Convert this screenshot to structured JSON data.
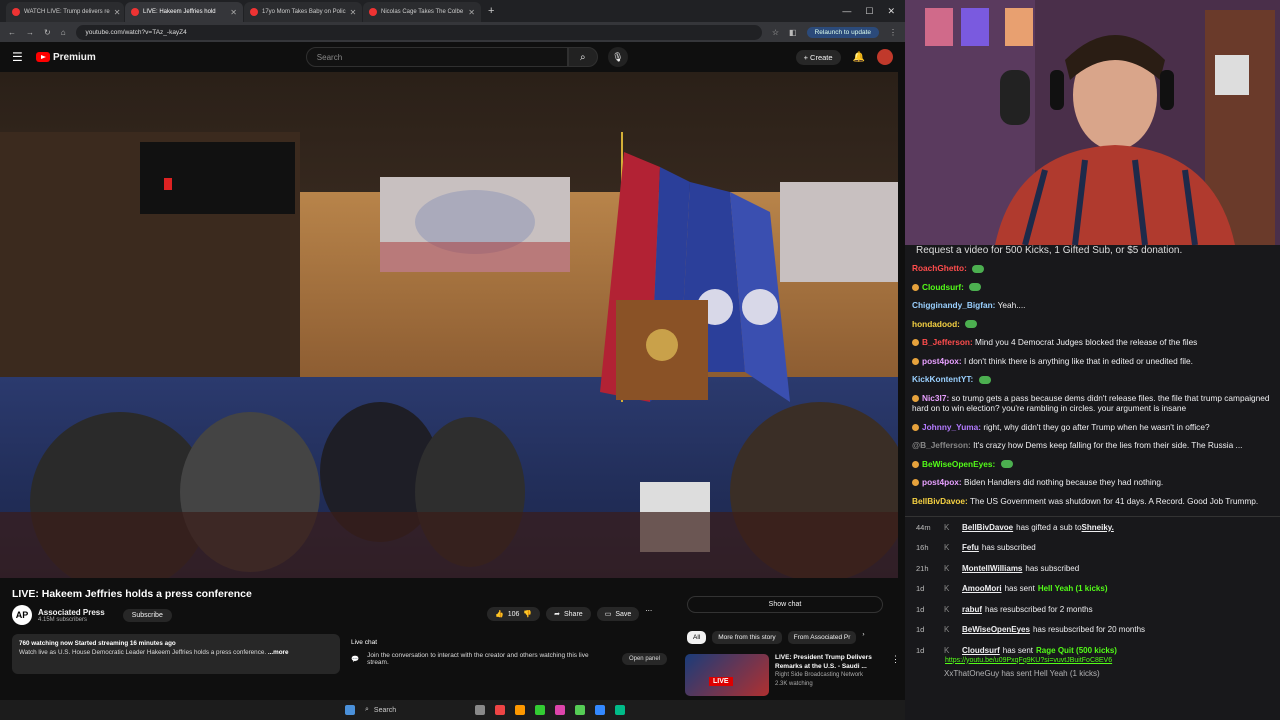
{
  "browser": {
    "tabs": [
      {
        "label": "WATCH LIVE: Trump delivers re"
      },
      {
        "label": "LIVE: Hakeem Jeffries hold"
      },
      {
        "label": "17yo Mom Takes Baby on Polic"
      },
      {
        "label": "Nicolas Cage Takes The Colbe"
      }
    ],
    "url": "youtube.com/watch?v=TAz_-kayZ4",
    "relaunch_label": "Relaunch to update"
  },
  "youtube": {
    "brand": "Premium",
    "search_placeholder": "Search",
    "create_label": "Create",
    "video_title": "LIVE: Hakeem Jeffries holds a press conference",
    "channel_initials": "AP",
    "channel_name": "Associated Press",
    "channel_subs": "4.15M subscribers",
    "subscribe_label": "Subscribe",
    "like_count": "106",
    "share_label": "Share",
    "save_label": "Save",
    "description_meta": "760 watching now  Started streaming 16 minutes ago",
    "description_text": "Watch live as U.S. House Democratic Leader Hakeem Jeffries holds a press conference.",
    "more_label": "...more",
    "live_chat_title": "Live chat",
    "live_chat_text": "Join the conversation to interact with the creator and others watching this live stream.",
    "open_panel_label": "Open panel",
    "show_chat_label": "Show chat",
    "chips": [
      "All",
      "More from this story",
      "From Associated Pr"
    ],
    "recommended": {
      "badge": "LIVE",
      "title": "LIVE: President Trump Delivers Remarks at the U.S. - Saudi ...",
      "channel": "Right Side Broadcasting Network",
      "meta": "2.3K watching"
    }
  },
  "taskbar": {
    "search_label": "Search"
  },
  "chat": {
    "request_text": "Request a video for 500 Kicks, 1 Gifted Sub, or $5 donation.",
    "messages": [
      {
        "user": "RoachGhetto:",
        "text": "",
        "color": "#ff4d4d"
      },
      {
        "user": "Cloudsurf:",
        "text": "",
        "color": "#53fc18"
      },
      {
        "user": "Chigginandy_Bigfan:",
        "text": "Yeah....",
        "color": "#9ad0ff"
      },
      {
        "user": "hondadood:",
        "text": "",
        "color": "#f5d142"
      },
      {
        "user": "B_Jefferson:",
        "text": "Mind you 4 Democrat Judges blocked the release of the files",
        "color": "#ff4d4d"
      },
      {
        "user": "post4pox:",
        "text": "I don't think there is anything like that in edited or unedited file.",
        "color": "#e8a0ff"
      },
      {
        "user": "KickKontentYT:",
        "text": "",
        "color": "#9ad0ff"
      },
      {
        "user": "Nic3l7:",
        "text": "so trump gets a pass because dems didn't release files. the file that trump campaigned hard on to win election? you're rambling in circles. your argument is insane",
        "color": "#e8a0ff"
      },
      {
        "user": "Johnny_Yuma:",
        "text": "right, why didn't they go after Trump when he wasn't in office?",
        "color": "#b37bff"
      },
      {
        "user": "@B_Jefferson:",
        "text": "It's crazy how Dems keep falling for the lies from their side. The Russia ...",
        "color": "#888888"
      },
      {
        "user": "BeWiseOpenEyes:",
        "text": "",
        "color": "#53fc18"
      },
      {
        "user": "post4pox:",
        "text": "Biden Handlers did nothing because they had nothing.",
        "color": "#e8a0ff"
      },
      {
        "user": "BellBivDavoe:",
        "text": "The US Government was shutdown for 41 days. A Record. Good Job Trummp.",
        "color": "#f5d142"
      }
    ],
    "events": [
      {
        "time": "44m",
        "user": "BellBivDavoe",
        "text": "has gifted a sub to",
        "extra": "Shneiky."
      },
      {
        "time": "16h",
        "user": "Fefu",
        "text": "has subscribed",
        "extra": ""
      },
      {
        "time": "21h",
        "user": "MontellWilliams",
        "text": "has subscribed",
        "extra": ""
      },
      {
        "time": "1d",
        "user": "AmooMori",
        "text": "has sent",
        "extra": "Hell Yeah (1 kicks)"
      },
      {
        "time": "1d",
        "user": "rabuf",
        "text": "has resubscribed for 2 months",
        "extra": ""
      },
      {
        "time": "1d",
        "user": "BeWiseOpenEyes",
        "text": "has resubscribed for 20 months",
        "extra": ""
      },
      {
        "time": "1d",
        "user": "Cloudsurf",
        "text": "has sent",
        "extra": "Rage Quit (500 kicks)"
      }
    ],
    "event_link": "https://youtu.be/u09PxqFq9KU?si=vuvtJBuitFoC8EV6",
    "last_event": "XxThatOneGuy has sent Hell Yeah (1 kicks)"
  }
}
